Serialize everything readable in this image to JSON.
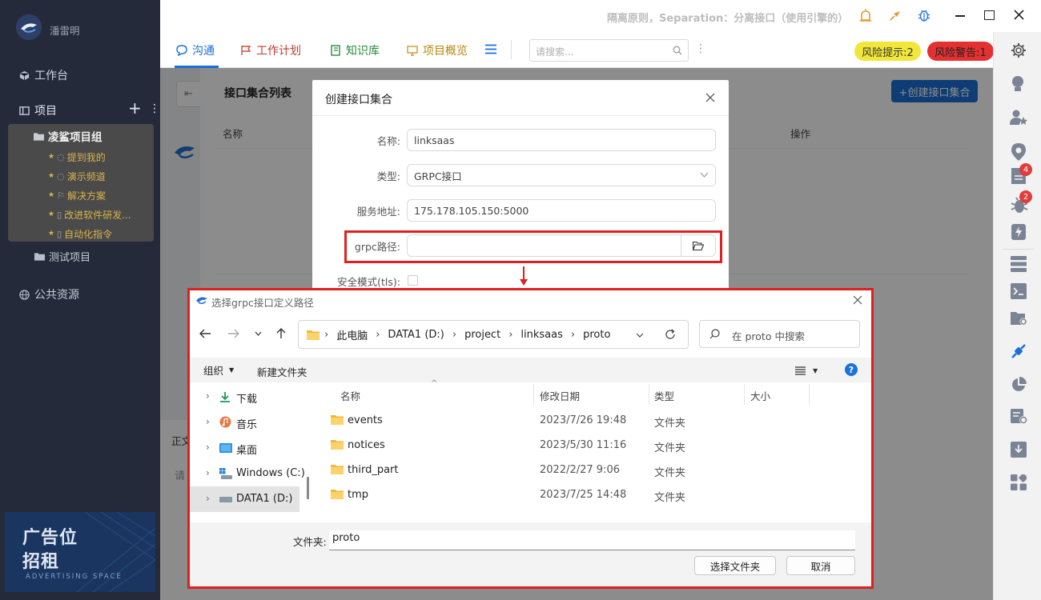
{
  "app": {
    "user_name": "潘雷明",
    "title_text": "隔离原则，Separation：分离接口（使用引擎的）",
    "colors": {
      "accent": "#1a6fd6",
      "sidebar_bg": "#242a3a",
      "highlight": "#e02020",
      "risk_tip": "#f1e63a",
      "risk_warn": "#e53030"
    }
  },
  "sidebar": {
    "workbench": "工作台",
    "projects": "项目",
    "group_name": "凌鲨项目组",
    "group_items": [
      "提到我的",
      "演示频道",
      "解决方案",
      "改进软件研发...",
      "自动化指令"
    ],
    "test_project": "测试项目",
    "public": "公共资源",
    "ad": {
      "line1": "广告位",
      "line2": "招租",
      "sub": "ADVERTISING SPACE"
    }
  },
  "tabs": [
    {
      "label": "沟通",
      "icon": "chat-icon"
    },
    {
      "label": "工作计划",
      "icon": "flag-icon"
    },
    {
      "label": "知识库",
      "icon": "book-icon"
    },
    {
      "label": "项目概览",
      "icon": "monitor-icon"
    }
  ],
  "search": {
    "placeholder": "请搜索..."
  },
  "risk": {
    "tip": "风险提示:2",
    "warn": "风险警告:1"
  },
  "badges": {
    "doc": "4",
    "bug": "2"
  },
  "panel": {
    "title": "接口集合列表",
    "create_button": "+创建接口集合",
    "col_name": "名称",
    "col_ops": "操作",
    "side_text1": "正文",
    "side_text2": "请"
  },
  "create_modal": {
    "title": "创建接口集合",
    "name_label": "名称:",
    "name_value": "linksaas",
    "type_label": "类型:",
    "type_value": "GRPC接口",
    "addr_label": "服务地址:",
    "addr_value": "175.178.105.150:5000",
    "path_label": "grpc路径:",
    "path_value": "",
    "tls_label": "安全模式(tls):"
  },
  "file_dialog": {
    "title": "选择grpc接口定义路径",
    "breadcrumb": [
      "此电脑",
      "DATA1 (D:)",
      "project",
      "linksaas",
      "proto"
    ],
    "search_placeholder": "在 proto 中搜索",
    "organize": "组织",
    "new_folder": "新建文件夹",
    "nav_items": [
      {
        "label": "下载",
        "icon": "download-icon"
      },
      {
        "label": "音乐",
        "icon": "music-icon"
      },
      {
        "label": "桌面",
        "icon": "desktop-icon"
      },
      {
        "label": "Windows (C:)",
        "icon": "drive-c-icon"
      },
      {
        "label": "DATA1 (D:)",
        "icon": "drive-d-icon"
      }
    ],
    "columns": [
      "名称",
      "修改日期",
      "类型",
      "大小"
    ],
    "files": [
      {
        "name": "events",
        "date": "2023/7/26 19:48",
        "type": "文件夹",
        "size": ""
      },
      {
        "name": "notices",
        "date": "2023/5/30 11:16",
        "type": "文件夹",
        "size": ""
      },
      {
        "name": "third_part",
        "date": "2022/2/27 9:06",
        "type": "文件夹",
        "size": ""
      },
      {
        "name": "tmp",
        "date": "2023/7/25 14:48",
        "type": "文件夹",
        "size": ""
      }
    ],
    "folder_label": "文件夹:",
    "folder_value": "proto",
    "select_button": "选择文件夹",
    "cancel_button": "取消"
  }
}
